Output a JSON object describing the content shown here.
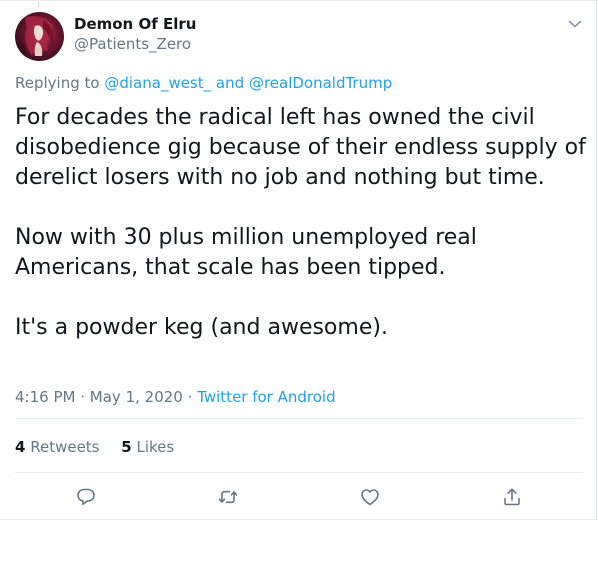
{
  "tweet": {
    "display_name": "Demon Of Elru",
    "handle": "@Patients_Zero",
    "replying_prefix": "Replying to",
    "replying_to": [
      "@diana_west_",
      "@realDonaldTrump"
    ],
    "replying_joiner": "and",
    "text": "For decades the radical left has owned the civil disobedience gig because of their endless supply of derelict losers with no job and nothing but time.\n\nNow with 30 plus million unemployed real Americans, that scale has been tipped.\n\nIt's a powder keg (and awesome).",
    "time": "4:16 PM",
    "date": "May 1, 2020",
    "separator": "·",
    "source": "Twitter for Android",
    "retweets_count": "4",
    "retweets_label": "Retweets",
    "likes_count": "5",
    "likes_label": "Likes"
  },
  "icons": {
    "menu": "chevron-down-icon",
    "reply": "reply-icon",
    "retweet": "retweet-icon",
    "like": "heart-icon",
    "share": "share-icon"
  },
  "colors": {
    "link": "#1da1f2",
    "secondary_text": "#657786",
    "primary_text": "#14171a",
    "border": "#e6ecf0"
  }
}
